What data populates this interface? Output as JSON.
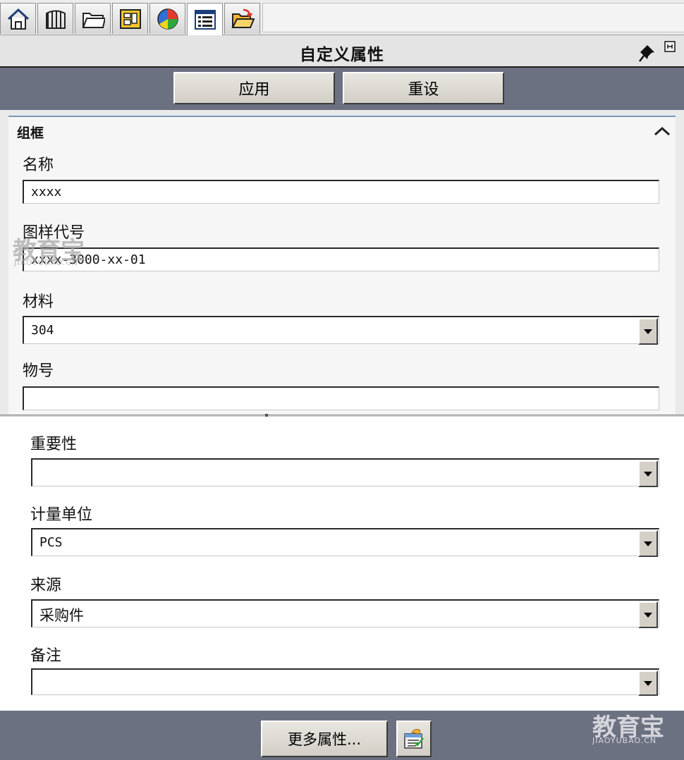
{
  "tabs": [
    {
      "name": "home-icon",
      "active": false
    },
    {
      "name": "tree-icon",
      "active": false
    },
    {
      "name": "folder-icon",
      "active": false
    },
    {
      "name": "layout-icon",
      "active": false
    },
    {
      "name": "color-wheel-icon",
      "active": false
    },
    {
      "name": "properties-list-icon",
      "active": true
    },
    {
      "name": "open-folder-icon",
      "active": false
    }
  ],
  "panel": {
    "title": "自定义属性",
    "apply_label": "应用",
    "reset_label": "重设"
  },
  "group": {
    "title": "组框"
  },
  "fields": {
    "name": {
      "label": "名称",
      "value": "xxxx"
    },
    "drawing_no": {
      "label": "图样代号",
      "value": "xxxx-3000-xx-01"
    },
    "material": {
      "label": "材料",
      "value": "304"
    },
    "item_no": {
      "label": "物号",
      "value": ""
    },
    "importance": {
      "label": "重要性",
      "value": ""
    },
    "unit": {
      "label": "计量单位",
      "value": "PCS"
    },
    "source": {
      "label": "来源",
      "value": "采购件"
    },
    "remark": {
      "label": "备注",
      "value": ""
    }
  },
  "footer": {
    "more_label": "更多属性..."
  },
  "watermark": {
    "brand": "教育宝",
    "url": "JIAOYUBAO.CN"
  },
  "colors": {
    "toolbar_bg": "#6c7181",
    "accent_line": "#7b97b8"
  }
}
